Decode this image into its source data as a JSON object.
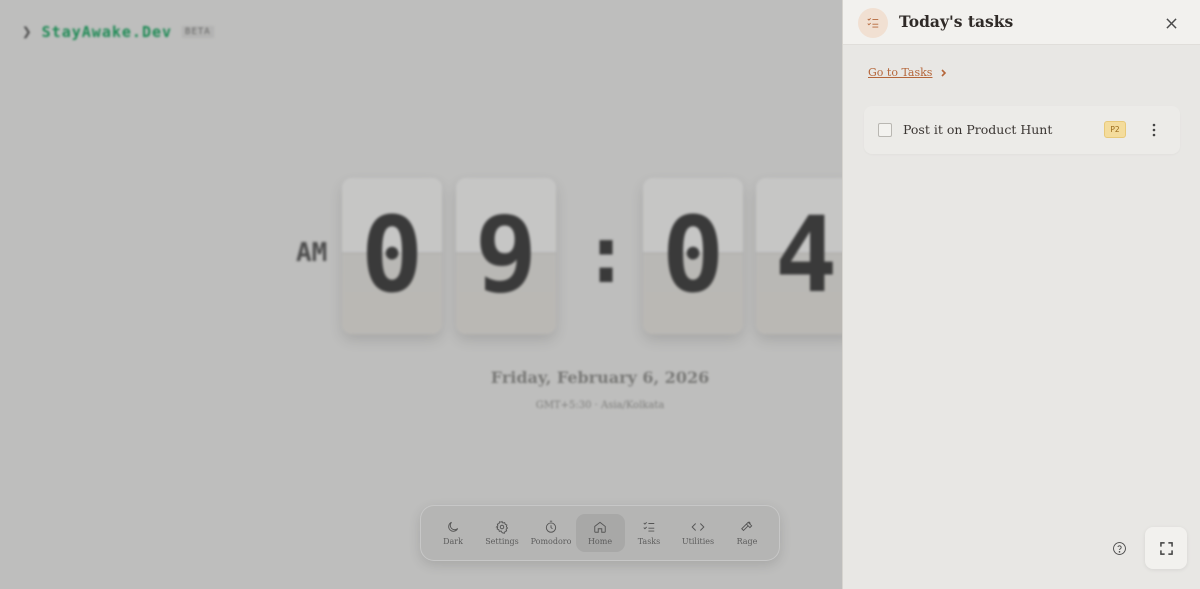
{
  "app": {
    "brand_prompt": "❯",
    "brand_name": "StayAwake.Dev",
    "brand_tag": "BETA"
  },
  "clock": {
    "meridiem": "AM",
    "hour_digits": [
      "0",
      "9"
    ],
    "separator": ":",
    "minute_digits": [
      "0",
      "4"
    ],
    "date": "Friday, February 6, 2026",
    "timezone_line": "GMT+5:30 · Asia/Kolkata"
  },
  "dock": {
    "items": [
      {
        "label": "Dark",
        "icon": "moon-icon"
      },
      {
        "label": "Settings",
        "icon": "gear-icon"
      },
      {
        "label": "Pomodoro",
        "icon": "timer-icon"
      },
      {
        "label": "Home",
        "icon": "home-icon",
        "active": true
      },
      {
        "label": "Tasks",
        "icon": "checklist-icon"
      },
      {
        "label": "Utilities",
        "icon": "code-icon"
      },
      {
        "label": "Rage",
        "icon": "hammer-icon"
      }
    ]
  },
  "panel": {
    "title": "Today's tasks",
    "goto_label": "Go to Tasks",
    "tasks": [
      {
        "text": "Post it on Product Hunt",
        "badge": "P2",
        "done": false
      }
    ]
  },
  "colors": {
    "accent": "#b5663a",
    "badge_bg": "#f4dc9c",
    "brand_green": "#1e8a55",
    "panel_bg": "#e8e7e4"
  }
}
